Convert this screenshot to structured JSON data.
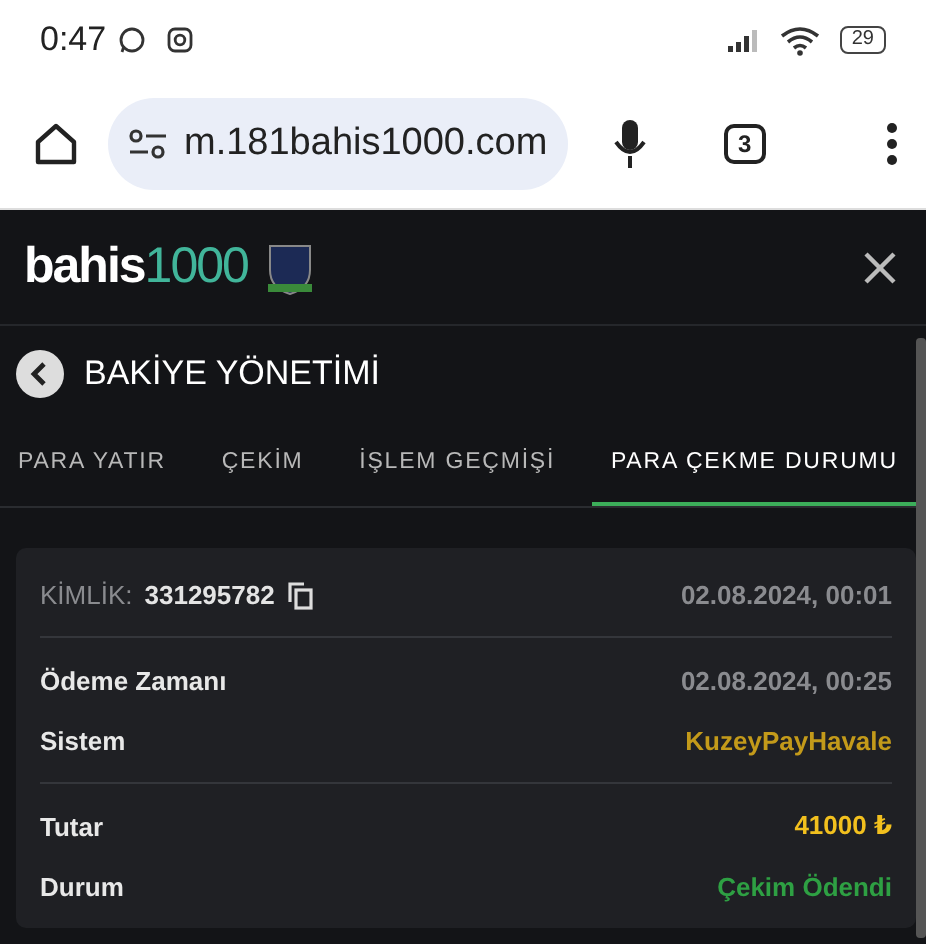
{
  "status_bar": {
    "time": "0:47",
    "battery": "29"
  },
  "browser": {
    "url": "m.181bahis1000.com",
    "tab_count": "3"
  },
  "header": {
    "logo": {
      "text": "bahis",
      "accent": "1000"
    }
  },
  "page": {
    "title": "BAKİYE YÖNETİMİ"
  },
  "tabs": [
    {
      "label": "PARA YATIR",
      "selected": false
    },
    {
      "label": "ÇEKİM",
      "selected": false
    },
    {
      "label": "İŞLEM GEÇMİŞİ",
      "selected": false
    },
    {
      "label": "PARA ÇEKME DURUMU",
      "selected": true
    }
  ],
  "card": {
    "id_label": "KİMLİK:",
    "id_value": "331295782",
    "created": "02.08.2024, 00:01",
    "groups": [
      [
        {
          "label": "Ödeme Zamanı",
          "value": "02.08.2024, 00:25",
          "kind": "date"
        },
        {
          "label": "Sistem",
          "value": "KuzeyPayHavale",
          "kind": "system"
        }
      ],
      [
        {
          "label": "Tutar",
          "value": "41000 ₺",
          "kind": "amount"
        },
        {
          "label": "Durum",
          "value": "Çekim Ödendi",
          "kind": "status"
        }
      ]
    ]
  }
}
